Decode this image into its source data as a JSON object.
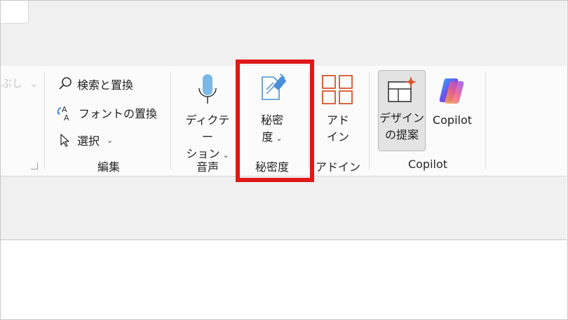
{
  "ribbon": {
    "cut_off_label": "ぶし",
    "edit_group": {
      "find_replace": "検索と置換",
      "font_replace": "フォントの置換",
      "select": "選択",
      "group_label": "編集"
    },
    "voice_group": {
      "dictate_line1": "ディクテー",
      "dictate_line2": "ション",
      "group_label": "音声"
    },
    "sensitivity_group": {
      "button_line1": "秘密",
      "button_line2": "度",
      "group_label": "秘密度"
    },
    "addins_group": {
      "button_line1": "アド",
      "button_line2": "イン",
      "group_label": "アドイン"
    },
    "copilot_group": {
      "designer_line1": "デザイン",
      "designer_line2": "の提案",
      "copilot_label": "Copilot",
      "group_label": "Copilot"
    }
  },
  "colors": {
    "highlight": "#e01818",
    "mic": "#7ab8e8",
    "addins": "#d8542a",
    "sensitivity": "#4a90d9"
  }
}
